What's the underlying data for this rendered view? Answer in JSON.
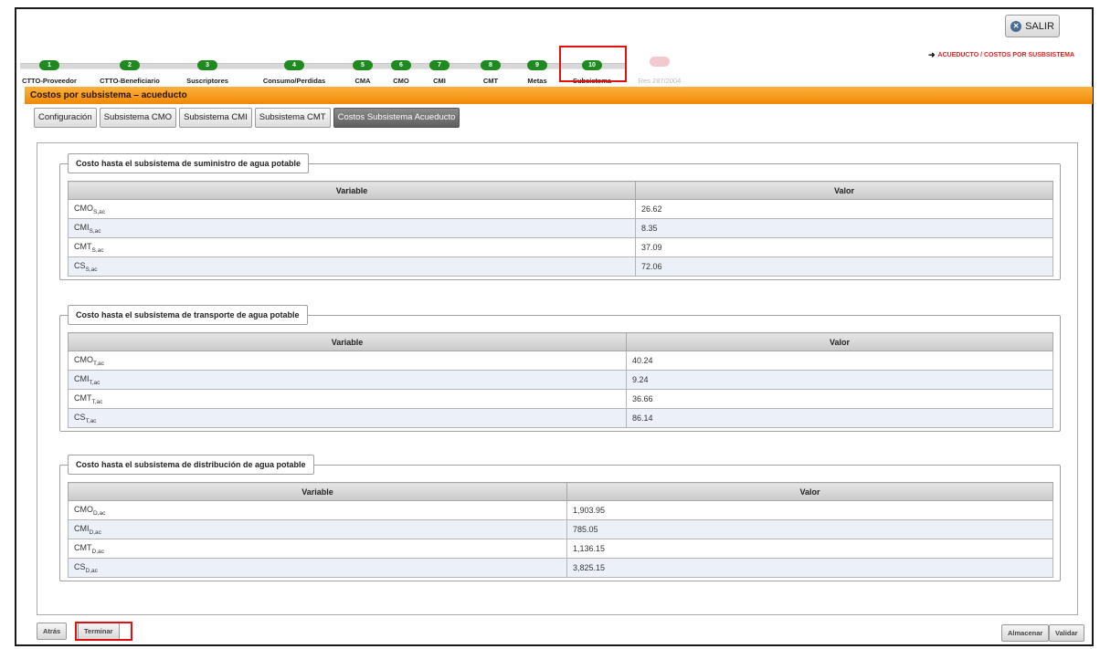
{
  "header": {
    "salir_label": "SALIR",
    "breadcrumb": "ACUEDUCTO / COSTOS POR SUSBSISTEMA"
  },
  "steps": [
    {
      "num": "1",
      "label": "CTTO-Proveedor"
    },
    {
      "num": "2",
      "label": "CTTO-Beneficiario"
    },
    {
      "num": "3",
      "label": "Suscriptores"
    },
    {
      "num": "4",
      "label": "Consumo/Perdidas"
    },
    {
      "num": "5",
      "label": "CMA"
    },
    {
      "num": "6",
      "label": "CMO"
    },
    {
      "num": "7",
      "label": "CMI"
    },
    {
      "num": "8",
      "label": "CMT"
    },
    {
      "num": "9",
      "label": "Metas"
    },
    {
      "num": "10",
      "label": "Subsistema"
    },
    {
      "num": "",
      "label": "Res 287/2004"
    }
  ],
  "section_title": "Costos por subsistema – acueducto",
  "subtabs": [
    "Configuración",
    "Subsistema CMO",
    "Subsistema CMI",
    "Subsistema CMT",
    "Costos Subsistema Acueducto"
  ],
  "table_headers": {
    "variable": "Variable",
    "valor": "Valor"
  },
  "groups": [
    {
      "title": "Costo hasta el subsistema de suministro de agua potable",
      "rows": [
        {
          "var": "CMO",
          "sub": "S,ac",
          "value": "26.62"
        },
        {
          "var": "CMI",
          "sub": "S,ac",
          "value": "8.35"
        },
        {
          "var": "CMT",
          "sub": "S,ac",
          "value": "37.09"
        },
        {
          "var": "CS",
          "sub": "S,ac",
          "value": "72.06"
        }
      ]
    },
    {
      "title": "Costo hasta el subsistema de transporte de agua potable",
      "rows": [
        {
          "var": "CMO",
          "sub": "T,ac",
          "value": "40.24"
        },
        {
          "var": "CMI",
          "sub": "T,ac",
          "value": "9.24"
        },
        {
          "var": "CMT",
          "sub": "T,ac",
          "value": "36.66"
        },
        {
          "var": "CS",
          "sub": "T,ac",
          "value": "86.14"
        }
      ]
    },
    {
      "title": "Costo hasta el subsistema de distribución de agua potable",
      "rows": [
        {
          "var": "CMO",
          "sub": "D,ac",
          "value": "1,903.95"
        },
        {
          "var": "CMI",
          "sub": "D,ac",
          "value": "785.05"
        },
        {
          "var": "CMT",
          "sub": "D,ac",
          "value": "1,136.15"
        },
        {
          "var": "CS",
          "sub": "D,ac",
          "value": "3,825.15"
        }
      ]
    }
  ],
  "footer": {
    "atras": "Atrás",
    "terminar": "Terminar",
    "almacenar": "Almacenar",
    "validar": "Validar"
  },
  "colors": {
    "step_active": "#1f8a1f",
    "highlight": "#e01010",
    "section_bar": "#f08a06"
  }
}
